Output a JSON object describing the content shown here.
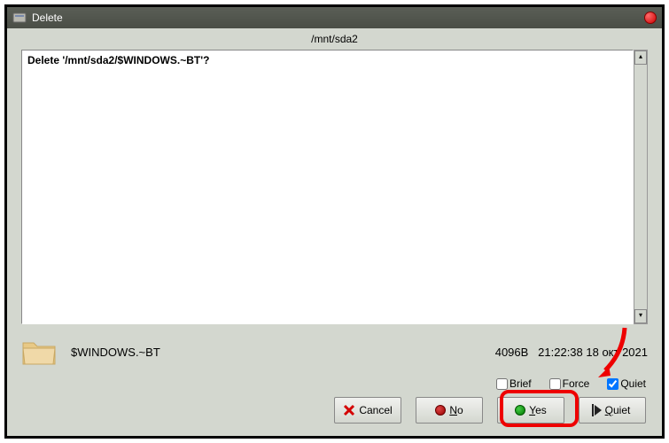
{
  "titlebar": {
    "title": "Delete"
  },
  "path": "/mnt/sda2",
  "message": "Delete '/mnt/sda2/$WINDOWS.~BT'?",
  "file": {
    "name": "$WINDOWS.~BT",
    "size": "4096B",
    "datetime": "21:22:38 18 окт 2021"
  },
  "checkboxes": {
    "brief": {
      "label": "Brief",
      "checked": false
    },
    "force": {
      "label": "Force",
      "checked": false
    },
    "quiet": {
      "label": "Quiet",
      "checked": true
    }
  },
  "buttons": {
    "cancel": "Cancel",
    "no": "No",
    "yes": "Yes",
    "quiet": "Quiet"
  }
}
